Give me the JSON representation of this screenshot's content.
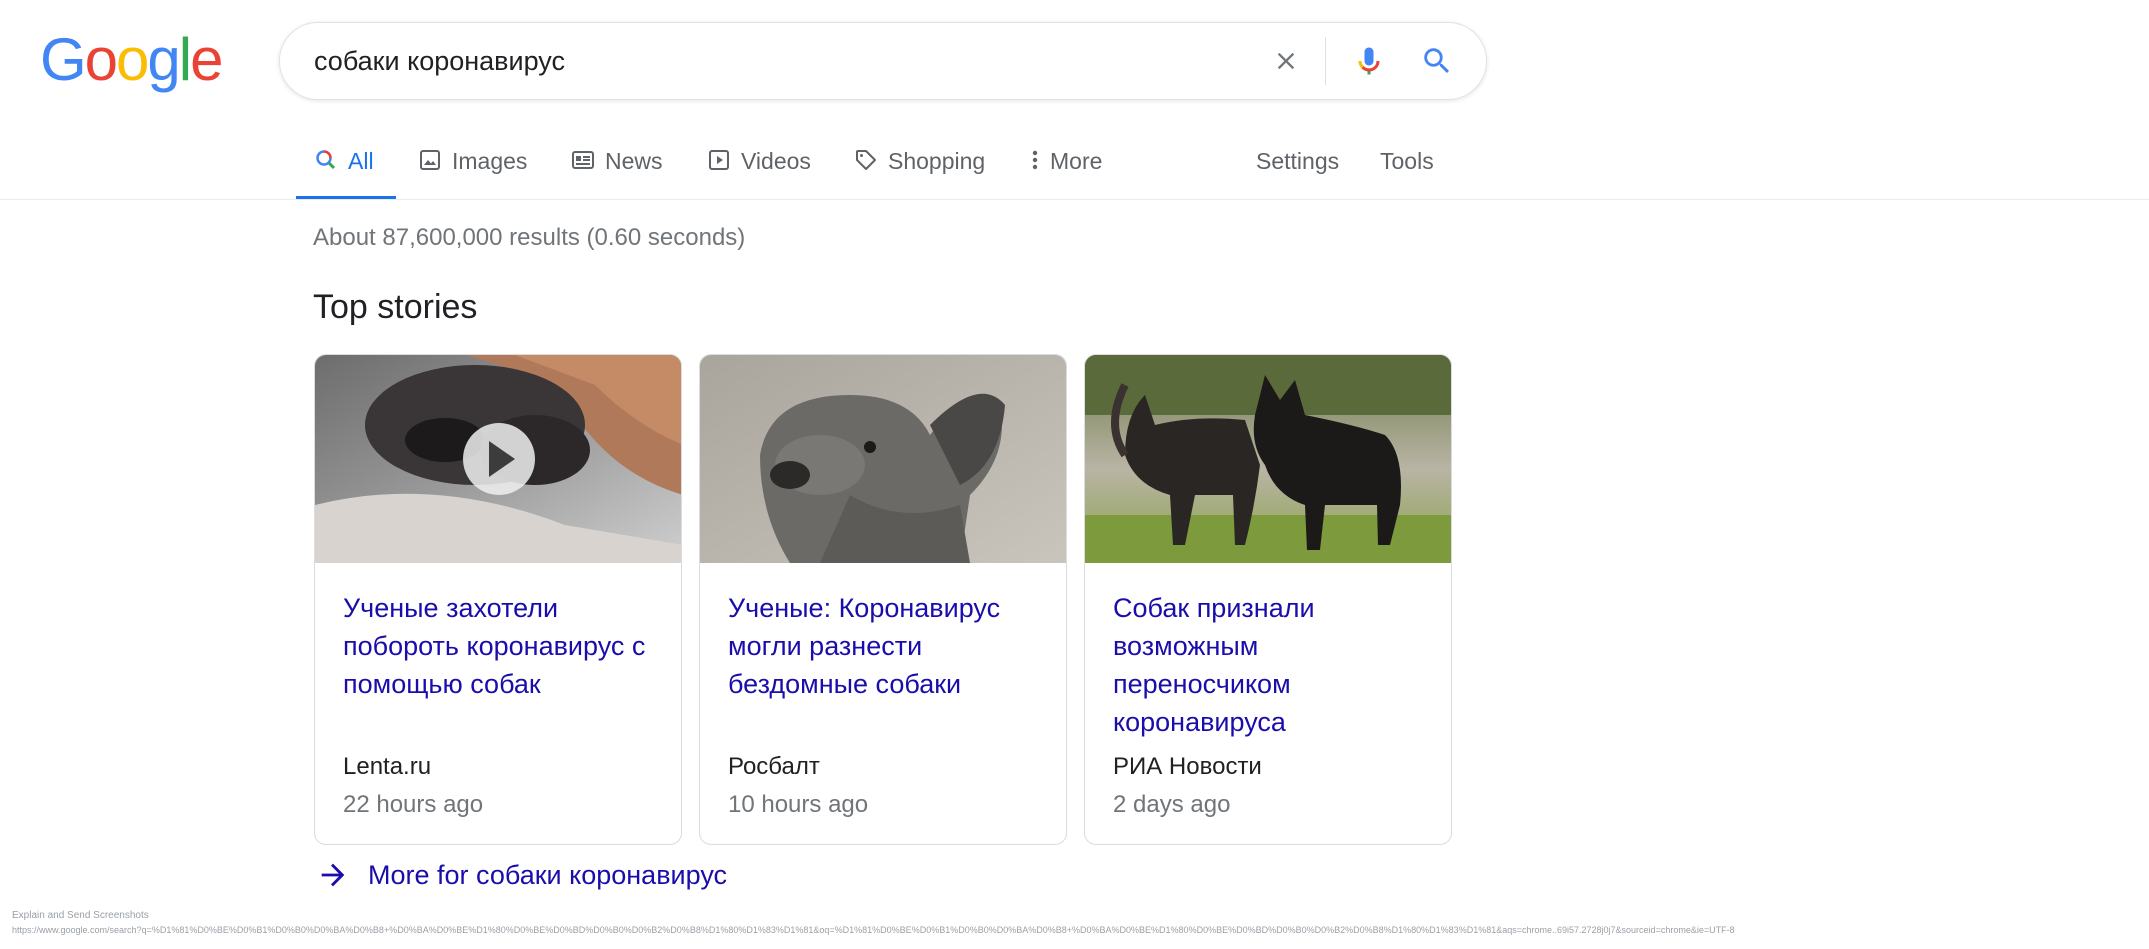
{
  "logo": {
    "letters": [
      "G",
      "o",
      "o",
      "g",
      "l",
      "e"
    ],
    "colors": [
      "#4285F4",
      "#EA4335",
      "#FBBC05",
      "#4285F4",
      "#34A853",
      "#EA4335"
    ]
  },
  "search": {
    "query": "собаки коронавирус"
  },
  "tabs": [
    {
      "label": "All",
      "icon": "search-icon",
      "active": true
    },
    {
      "label": "Images",
      "icon": "image-icon"
    },
    {
      "label": "News",
      "icon": "news-icon"
    },
    {
      "label": "Videos",
      "icon": "video-icon"
    },
    {
      "label": "Shopping",
      "icon": "tag-icon"
    },
    {
      "label": "More",
      "icon": "more-vertical-icon"
    }
  ],
  "tools": {
    "settings": "Settings",
    "tools": "Tools"
  },
  "result_stats": "About 87,600,000 results (0.60 seconds)",
  "top_stories": {
    "heading": "Top stories",
    "cards": [
      {
        "title": "Ученые захотели побороть коронавирус с помощью собак",
        "source": "Lenta.ru",
        "time": "22 hours ago",
        "has_video": true
      },
      {
        "title": "Ученые: Коронавирус могли разнести бездомные собаки",
        "source": "Росбалт",
        "time": "10 hours ago"
      },
      {
        "title": "Собак признали возможным переносчиком коронавируса",
        "source": "РИА Новости",
        "time": "2 days ago"
      }
    ],
    "more_label": "More for собаки коронавирус"
  },
  "footer": {
    "line1": "Explain and Send Screenshots",
    "line2": "https://www.google.com/search?q=%D1%81%D0%BE%D0%B1%D0%B0%D0%BA%D0%B8+%D0%BA%D0%BE%D1%80%D0%BE%D0%BD%D0%B0%D0%B2%D0%B8%D1%80%D1%83%D1%81&oq=%D1%81%D0%BE%D0%B1%D0%B0%D0%BA%D0%B8+%D0%BA%D0%BE%D1%80%D0%BE%D0%BD%D0%B0%D0%B2%D0%B8%D1%80%D1%83%D1%81&aqs=chrome..69i57.2728j0j7&sourceid=chrome&ie=UTF-8"
  }
}
